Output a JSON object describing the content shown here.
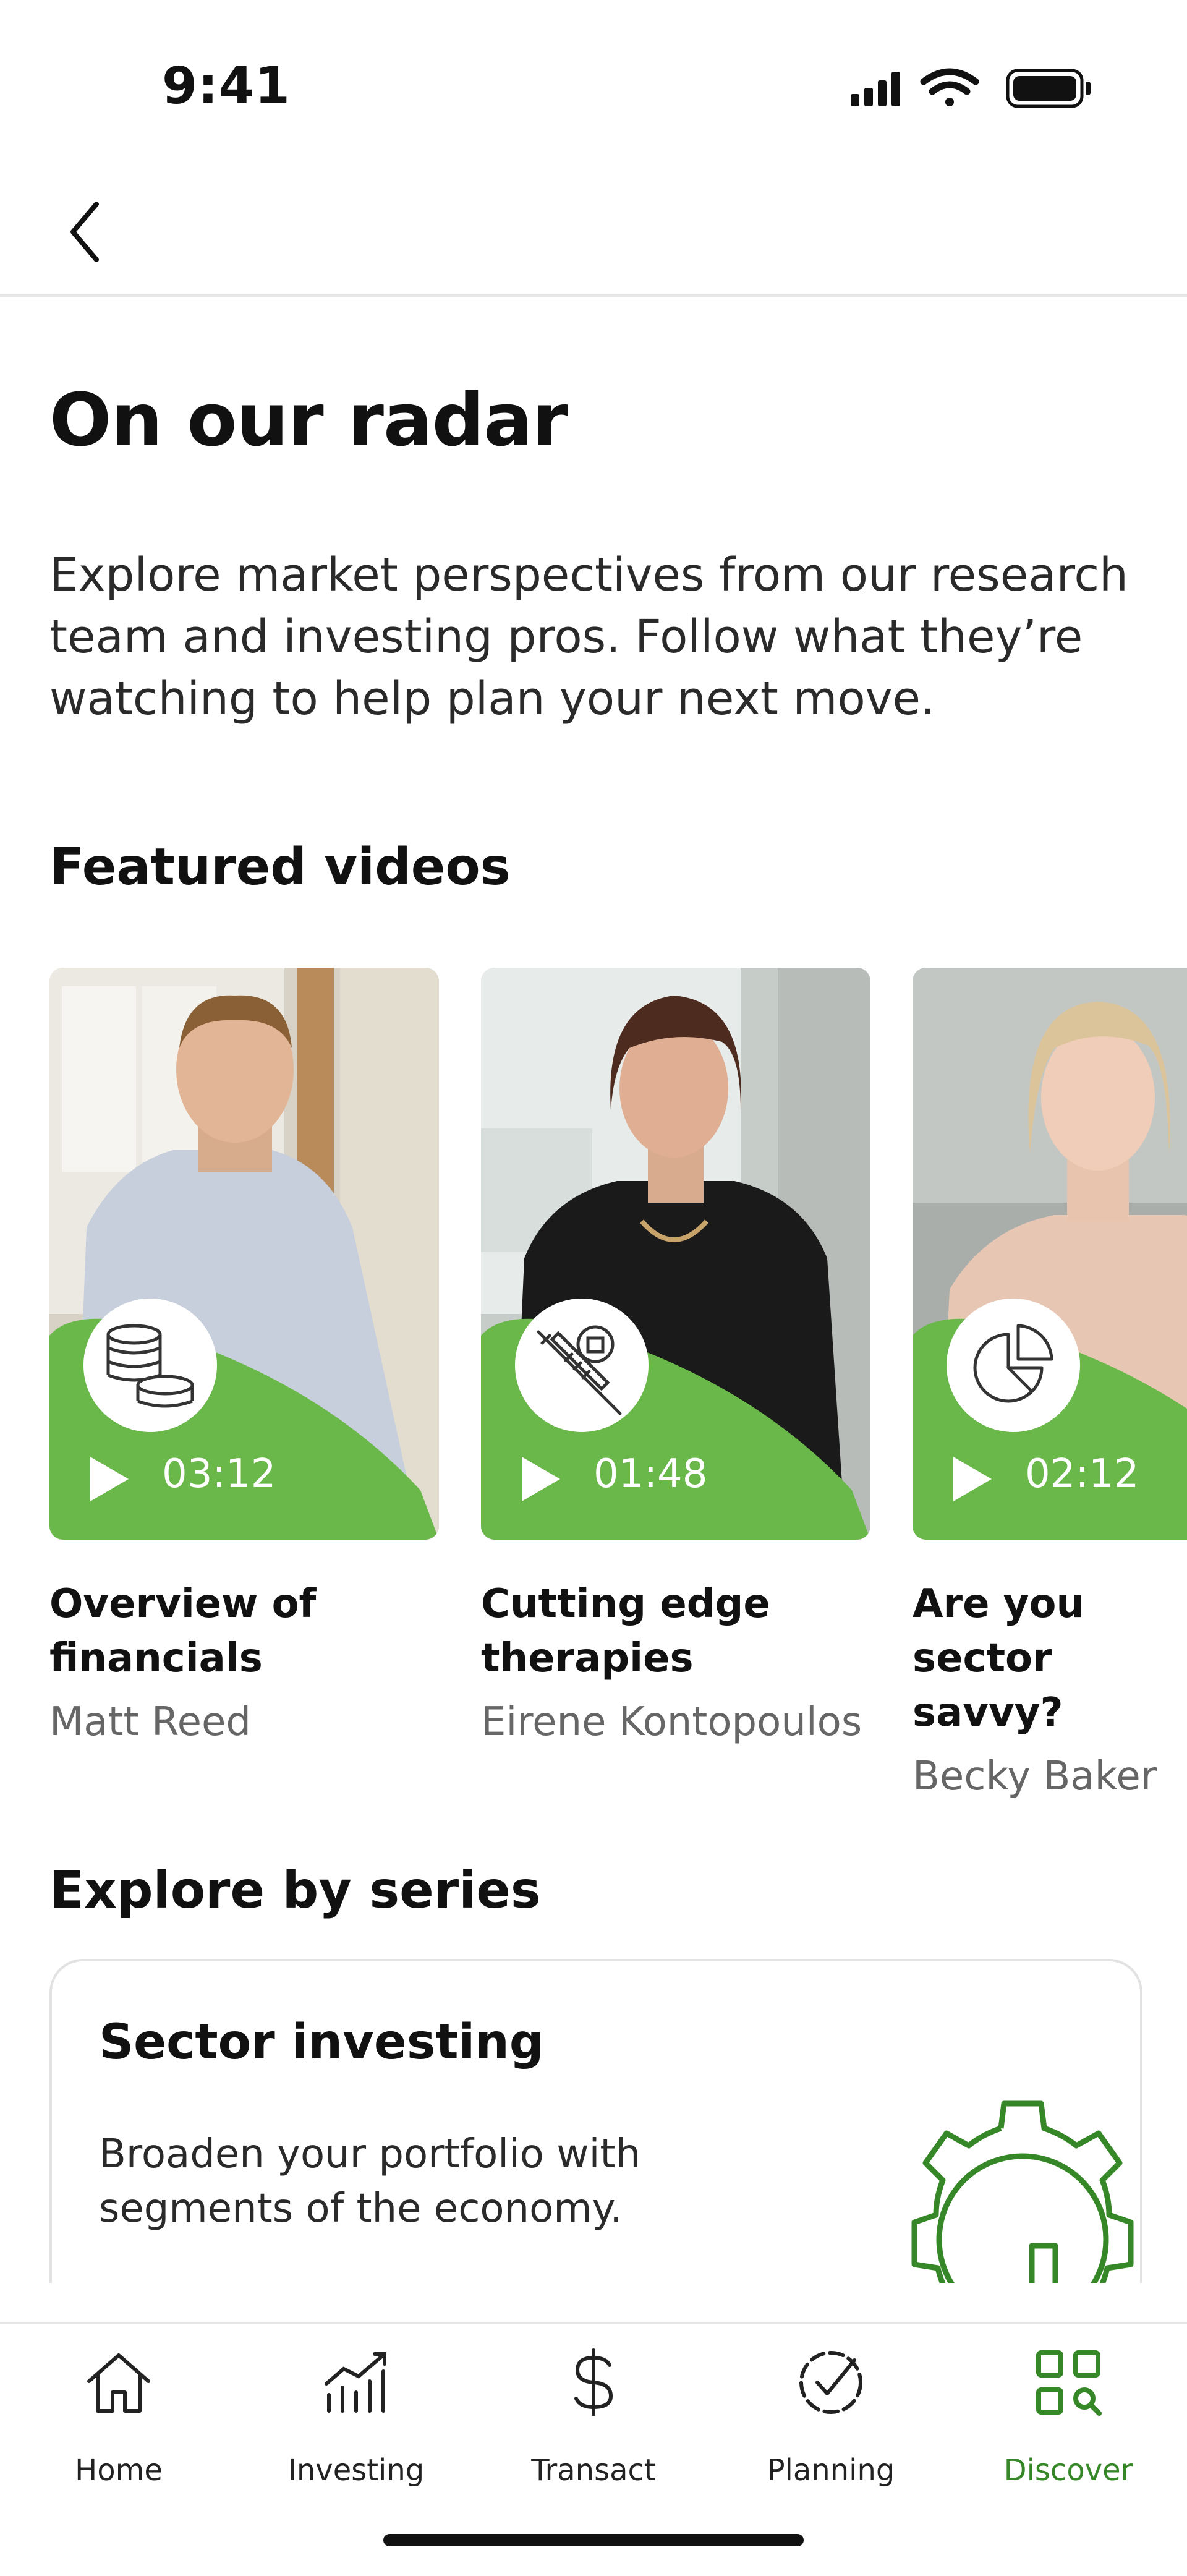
{
  "status_bar": {
    "time": "9:41"
  },
  "header": {
    "title": "On our radar",
    "intro": "Explore market perspectives from our research team and investing pros. Follow what they’re watching to help plan your next move."
  },
  "featured": {
    "heading": "Featured videos",
    "videos": [
      {
        "duration": "03:12",
        "title": "Overview of financials",
        "author": "Matt Reed",
        "icon": "coins-icon"
      },
      {
        "duration": "01:48",
        "title": "Cutting edge therapies",
        "author": "Eirene Kontopoulos",
        "icon": "syringe-icon"
      },
      {
        "duration": "02:12",
        "title": "Are you sector savvy?",
        "author": "Becky Baker",
        "icon": "pie-chart-icon"
      }
    ]
  },
  "series": {
    "heading": "Explore by series",
    "cards": [
      {
        "title": "Sector investing",
        "description": "Broaden your portfolio with segments of the economy."
      }
    ]
  },
  "tab_bar": {
    "tabs": [
      {
        "label": "Home",
        "icon": "home-icon"
      },
      {
        "label": "Investing",
        "icon": "investing-chart-icon"
      },
      {
        "label": "Transact",
        "icon": "dollar-icon"
      },
      {
        "label": "Planning",
        "icon": "planning-check-icon"
      },
      {
        "label": "Discover",
        "icon": "discover-grid-icon",
        "active": true
      }
    ]
  },
  "colors": {
    "brand_green": "#368727",
    "thumb_green": "#6ab84a",
    "text": "#111111",
    "muted": "#666666"
  }
}
